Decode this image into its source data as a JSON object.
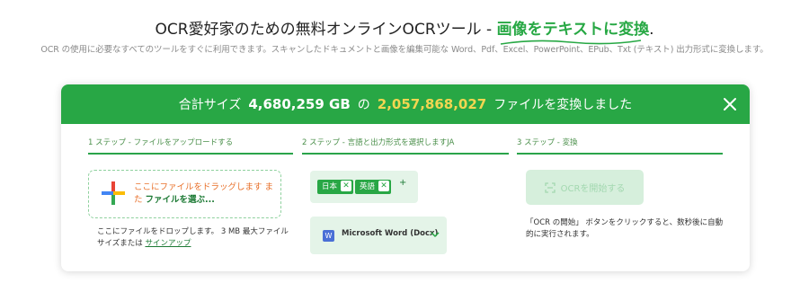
{
  "header": {
    "headline_prefix": "OCR愛好家のための無料オンラインOCRツール - ",
    "headline_highlight": "画像をテキストに変換",
    "headline_suffix": ".",
    "subline": "OCR の使用に必要なすべてのツールをすぐに利用できます。スキャンしたドキュメントと画像を編集可能な Word、Pdf、Excel、PowerPoint、EPub、Txt (テキスト) 出力形式に変換します。"
  },
  "banner": {
    "prefix": "合計サイズ",
    "total_size": "4,680,259 GB",
    "middle": "の",
    "file_count": "2,057,868,027",
    "suffix": "ファイルを変換しました",
    "close_icon": "close-icon"
  },
  "steps": [
    {
      "label": "1 ステップ - ファイルをアップロードする"
    },
    {
      "label": "2 ステップ - 言語と出力形式を選択しますJA"
    },
    {
      "label": "3 ステップ - 変換"
    }
  ],
  "upload": {
    "drop_text": "ここにファイルをドラッグします また",
    "choose_text": "ファイルを選ぶ...",
    "note_prefix": "ここにファイルをドロップします。 3 MB 最大ファイル サイズまたは",
    "note_link": "サインアップ",
    "icon": "plus-icon"
  },
  "languages": {
    "selected": [
      "日本",
      "英語"
    ],
    "remove_symbol": "✕",
    "add_symbol": "+"
  },
  "format": {
    "icon_letter": "W",
    "selected": "Microsoft Word (Docx)"
  },
  "convert": {
    "button_label": "OCRを開始する",
    "note": "「OCR の開始」 ボタンをクリックすると、数秒後に自動的に実行されます。"
  },
  "colors": {
    "brand_green": "#28a745",
    "highlight_gold": "#f3d651",
    "upload_orange": "#e8702a"
  }
}
